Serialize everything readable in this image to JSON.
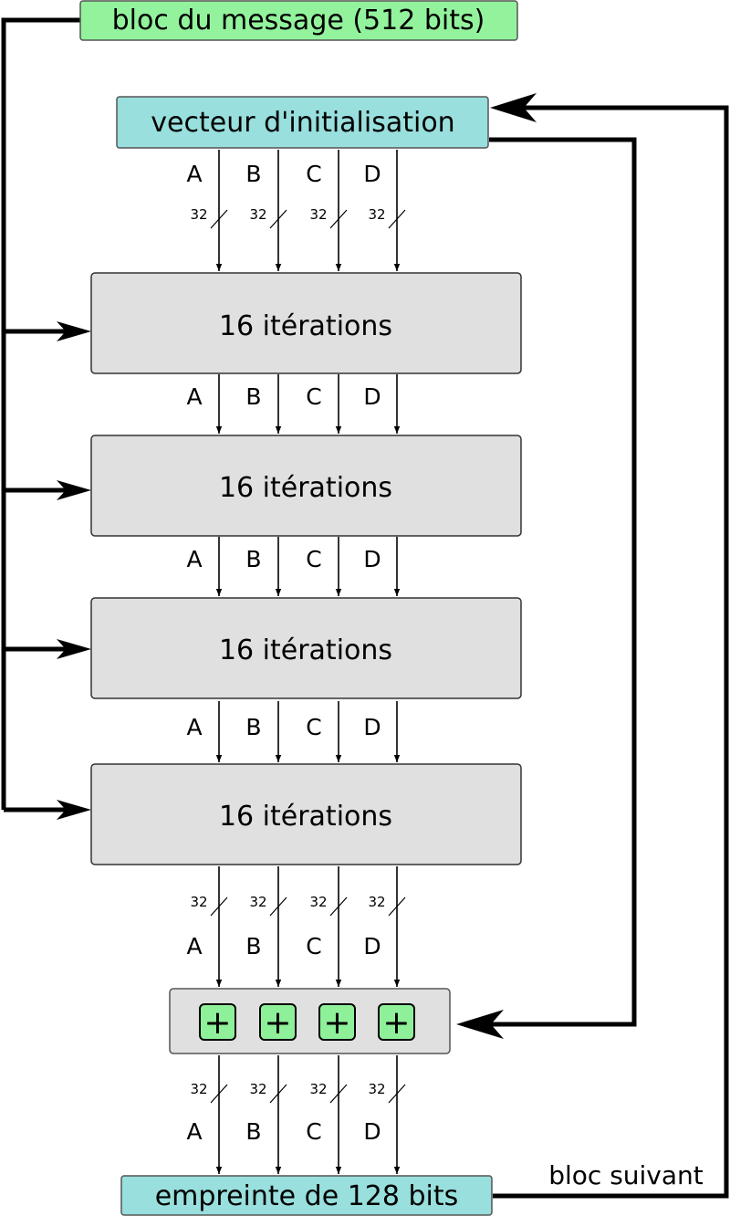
{
  "message_block": {
    "label": "bloc du message (512 bits)",
    "color": "#93f39d"
  },
  "init_vector": {
    "label": "vecteur d'initialisation",
    "color": "#98dfdd"
  },
  "rounds": [
    {
      "label": "16 itérations"
    },
    {
      "label": "16 itérations"
    },
    {
      "label": "16 itérations"
    },
    {
      "label": "16 itérations"
    }
  ],
  "round_color": "#e0e0e0",
  "adder_color": "#e0e0e0",
  "plus_color": "#8ff09a",
  "plus_symbol": "+",
  "buses": [
    "A",
    "B",
    "C",
    "D"
  ],
  "bus_width": "32",
  "output": {
    "label": "empreinte de 128 bits",
    "color": "#98dfdd"
  },
  "next_block_label": "bloc suivant"
}
